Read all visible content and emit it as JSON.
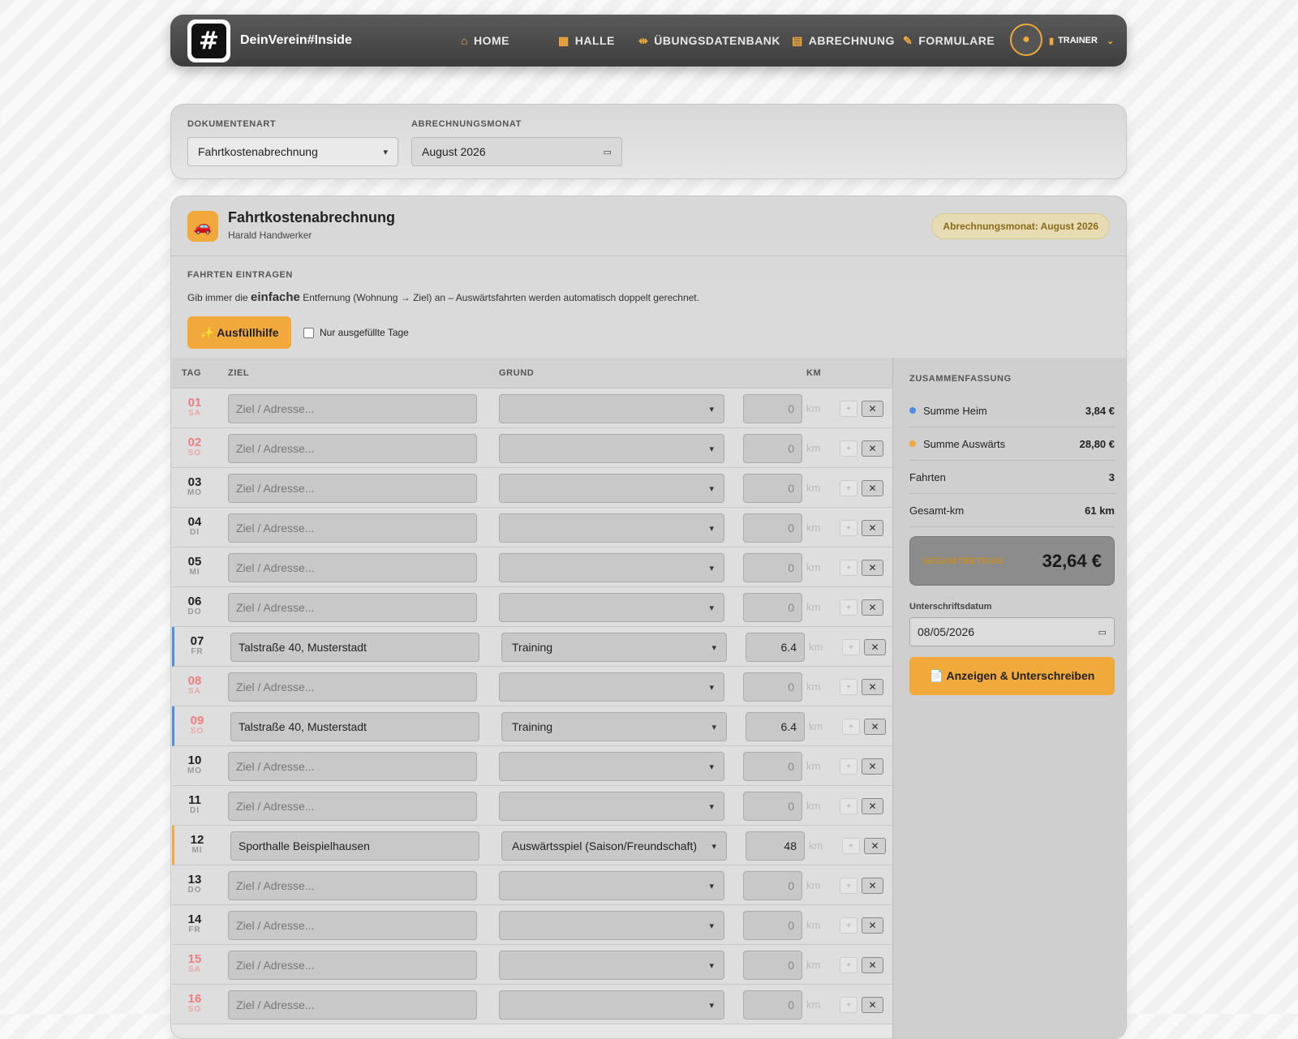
{
  "nav": {
    "logo_symbol": "#",
    "brand": "DeinVerein#Inside",
    "items": [
      {
        "label": "HOME",
        "icon": "home-icon"
      },
      {
        "label": "HALLE",
        "icon": "calendar-icon"
      },
      {
        "label": "ÜBUNGSDATENBANK",
        "icon": "dumbbell-icon"
      },
      {
        "label": "ABRECHNUNG",
        "icon": "document-icon"
      },
      {
        "label": "FORMULARE",
        "icon": "signature-icon"
      }
    ],
    "role": "TRAINER"
  },
  "filters": {
    "dokumentenart_label": "DOKUMENTENART",
    "dokumentenart_value": "Fahrtkostenabrechnung",
    "monat_label": "ABRECHNUNGSMONAT",
    "monat_value": "August 2026"
  },
  "form": {
    "title": "Fahrtkostenabrechnung",
    "person": "Harald Handwerker",
    "badge": "Abrechnungsmonat: August 2026",
    "section_label": "FAHRTEN EINTRAGEN",
    "hint_before": "Gib immer die",
    "hint_emph": "einfache",
    "hint_after": "Entfernung (Wohnung → Ziel) an – Auswärtsfahrten werden automatisch doppelt gerechnet.",
    "ausfuellhilfe_label": "✨ Ausfüllhilfe",
    "only_filled_label": "Nur ausgefüllte Tage"
  },
  "table": {
    "headers": {
      "tag": "TAG",
      "ziel": "ZIEL",
      "grund": "GRUND",
      "km": "KM"
    },
    "ziel_placeholder": "Ziel / Adresse...",
    "km_unit": "km",
    "rows": [
      {
        "day": "01",
        "weekday": "SA",
        "weekend": true,
        "ziel": "",
        "grund": "",
        "km": "0",
        "type": ""
      },
      {
        "day": "02",
        "weekday": "SO",
        "weekend": true,
        "ziel": "",
        "grund": "",
        "km": "0",
        "type": ""
      },
      {
        "day": "03",
        "weekday": "MO",
        "weekend": false,
        "ziel": "",
        "grund": "",
        "km": "0",
        "type": ""
      },
      {
        "day": "04",
        "weekday": "DI",
        "weekend": false,
        "ziel": "",
        "grund": "",
        "km": "0",
        "type": ""
      },
      {
        "day": "05",
        "weekday": "MI",
        "weekend": false,
        "ziel": "",
        "grund": "",
        "km": "0",
        "type": ""
      },
      {
        "day": "06",
        "weekday": "DO",
        "weekend": false,
        "ziel": "",
        "grund": "",
        "km": "0",
        "type": ""
      },
      {
        "day": "07",
        "weekday": "FR",
        "weekend": false,
        "ziel": "Talstraße 40, Musterstadt",
        "grund": "Training",
        "km": "6.4",
        "type": "heim"
      },
      {
        "day": "08",
        "weekday": "SA",
        "weekend": true,
        "ziel": "",
        "grund": "",
        "km": "0",
        "type": ""
      },
      {
        "day": "09",
        "weekday": "SO",
        "weekend": true,
        "ziel": "Talstraße 40, Musterstadt",
        "grund": "Training",
        "km": "6.4",
        "type": "heim"
      },
      {
        "day": "10",
        "weekday": "MO",
        "weekend": false,
        "ziel": "",
        "grund": "",
        "km": "0",
        "type": ""
      },
      {
        "day": "11",
        "weekday": "DI",
        "weekend": false,
        "ziel": "",
        "grund": "",
        "km": "0",
        "type": ""
      },
      {
        "day": "12",
        "weekday": "MI",
        "weekend": false,
        "ziel": "Sporthalle Beispielhausen",
        "grund": "Auswärtsspiel (Saison/Freundschaft)",
        "km": "48",
        "type": "auswaerts"
      },
      {
        "day": "13",
        "weekday": "DO",
        "weekend": false,
        "ziel": "",
        "grund": "",
        "km": "0",
        "type": ""
      },
      {
        "day": "14",
        "weekday": "FR",
        "weekend": false,
        "ziel": "",
        "grund": "",
        "km": "0",
        "type": ""
      },
      {
        "day": "15",
        "weekday": "SA",
        "weekend": true,
        "ziel": "",
        "grund": "",
        "km": "0",
        "type": ""
      },
      {
        "day": "16",
        "weekday": "SO",
        "weekend": true,
        "ziel": "",
        "grund": "",
        "km": "0",
        "type": ""
      }
    ]
  },
  "summary": {
    "label": "ZUSAMMENFASSUNG",
    "heim_label": "Summe Heim",
    "heim_value": "3,84 €",
    "heim_color": "#4a8ee6",
    "auswaerts_label": "Summe Auswärts",
    "auswaerts_value": "28,80 €",
    "auswaerts_color": "#f0a93a",
    "fahrten_label": "Fahrten",
    "fahrten_value": "3",
    "km_label": "Gesamt-km",
    "km_value": "61 km",
    "total_label": "GESAMTBETRAG",
    "total_value": "32,64 €",
    "date_label": "Unterschriftsdatum",
    "date_value": "08/05/2026",
    "sign_button": "📄 Anzeigen & Unterschreiben"
  },
  "colors": {
    "accent": "#f0a93a",
    "heim": "#4a8ee6"
  }
}
